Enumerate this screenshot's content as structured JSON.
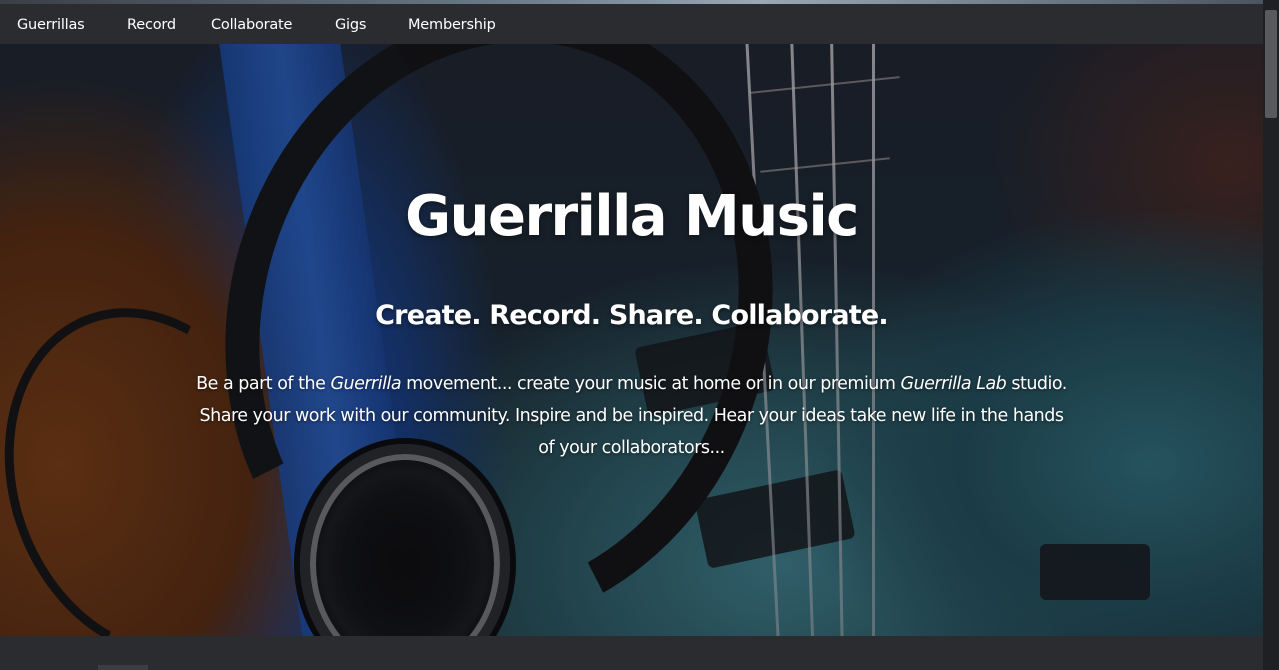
{
  "nav": {
    "items": [
      {
        "label": "Guerrillas"
      },
      {
        "label": "Record"
      },
      {
        "label": "Collaborate"
      },
      {
        "label": "Gigs"
      },
      {
        "label": "Membership"
      }
    ]
  },
  "hero": {
    "title": "Guerrilla Music",
    "subtitle": "Create. Record. Share. Collaborate.",
    "body": {
      "part1": "Be a part of the ",
      "em1": "Guerrilla",
      "part2": " movement... create your music at home or in our premium ",
      "em2": "Guerrilla Lab",
      "part3": " studio. Share your work with our community. Inspire and be inspired. Hear your ideas take new life in the hands of your collaborators..."
    },
    "background_image": "headphones-and-bass-guitar-photo"
  },
  "colors": {
    "navbar_bg": "#2b2c30",
    "text": "#ffffff",
    "scrollbar_thumb": "#595a5e"
  }
}
